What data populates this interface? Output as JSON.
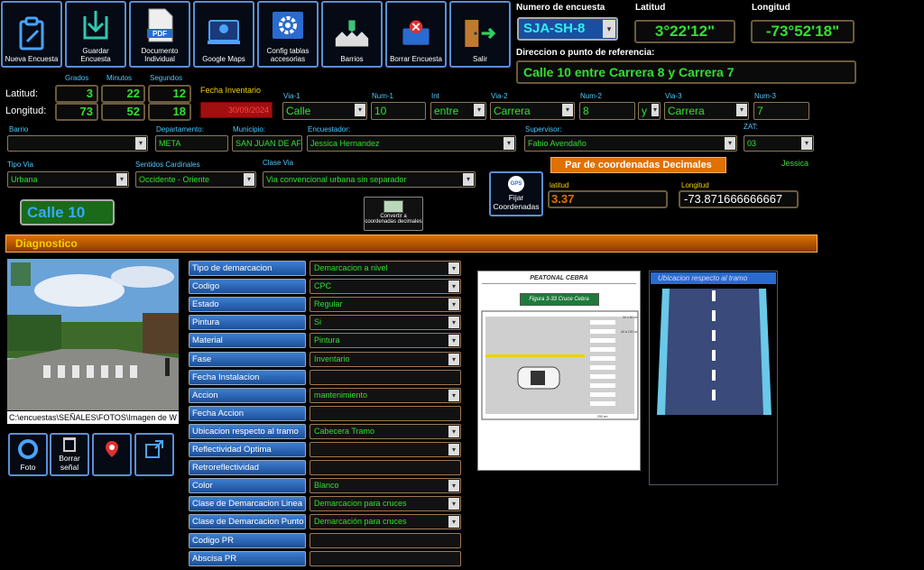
{
  "toolbar": [
    {
      "label": "Nueva Encuesta",
      "icon": "new-survey-icon"
    },
    {
      "label": "Guardar Encuesta",
      "icon": "save-icon"
    },
    {
      "label": "Documento Individual",
      "icon": "pdf-icon"
    },
    {
      "label": "Google Maps",
      "icon": "map-icon"
    },
    {
      "label": "Config tablas accesorias",
      "icon": "gear-icon"
    },
    {
      "label": "Barrios",
      "icon": "houses-icon"
    },
    {
      "label": "Borrar Encuesta",
      "icon": "delete-icon"
    },
    {
      "label": "Salir",
      "icon": "exit-icon"
    }
  ],
  "header": {
    "survey_label": "Numero de encuesta",
    "survey_value": "SJA-SH-8",
    "lat_label": "Latitud",
    "lat_value": "3°22'12\"",
    "lon_label": "Longitud",
    "lon_value": "-73°52'18\"",
    "address_label": "Direccion o punto de referencia:",
    "address_value": "Calle 10 entre Carrera 8 y Carrera 7"
  },
  "coords": {
    "grados": "Grados",
    "minutos": "Minutos",
    "segundos": "Segundos",
    "lat_label": "Latitud:",
    "lon_label": "Longitud:",
    "lat": [
      "3",
      "22",
      "12"
    ],
    "lon": [
      "73",
      "52",
      "18"
    ]
  },
  "inventory": {
    "label": "Fecha Inventario",
    "value": "30/09/2024"
  },
  "via": {
    "via1_label": "Via-1",
    "via1": "Calle",
    "num1_label": "Num-1",
    "num1": "10",
    "int_label": "Int",
    "int": "entre",
    "via2_label": "Via-2",
    "via2": "Carrera",
    "num2_label": "Num-2",
    "num2": "8",
    "sep": "y",
    "via3_label": "Via-3",
    "via3": "Carrera",
    "num3_label": "Num-3",
    "num3": "7"
  },
  "location": {
    "barrio_label": "Barrio",
    "barrio": "",
    "depto_label": "Departamento:",
    "depto": "META",
    "muni_label": "Municipio:",
    "muni": "SAN JUAN DE AF",
    "enc_label": "Encuestador:",
    "enc": "Jessica Hernandez",
    "sup_label": "Supervisor:",
    "sup": "Fabio Avendaño",
    "zat_label": "ZAT:",
    "zat": "03"
  },
  "tipo": {
    "tipo_label": "Tipo Via",
    "tipo": "Urbana",
    "sent_label": "Sentidos  Cardinales",
    "sent": "Occidente - Oriente",
    "clase_label": "Clase Via",
    "clase": "Via convencional urbana sin separador"
  },
  "decimal": {
    "title": "Par de coordenadas Decimales",
    "user": "Jessica",
    "fix_label": "Fijar Coordenadas",
    "fix_icon": "GPS",
    "lat_label": "latitud",
    "lat": "3.37",
    "lon_label": "Longitud",
    "lon": "-73.871666666667",
    "convert_label": "Convertir a coordenadas decimales"
  },
  "street_badge": "Calle 10",
  "diagnostico": {
    "title": "Diagnostico",
    "rows": [
      {
        "label": "Tipo de demarcacion",
        "value": "Demarcacion a nivel",
        "dropdown": true
      },
      {
        "label": "Codigo",
        "value": "CPC",
        "dropdown": true
      },
      {
        "label": "Estado",
        "value": "Regular",
        "dropdown": true
      },
      {
        "label": "Pintura",
        "value": "Si",
        "dropdown": true
      },
      {
        "label": "Material",
        "value": "Pintura",
        "dropdown": true
      },
      {
        "label": "Fase",
        "value": "Inventario",
        "dropdown": true
      },
      {
        "label": "Fecha Instalacion",
        "value": "",
        "dropdown": false
      },
      {
        "label": "Accion",
        "value": "mantenimiento",
        "dropdown": true
      },
      {
        "label": "Fecha Accion",
        "value": "",
        "dropdown": false
      },
      {
        "label": "Ubicacion respecto al tramo",
        "value": "Cabecera Tramo",
        "dropdown": true
      },
      {
        "label": "Reflectividad Optima",
        "value": "",
        "dropdown": true
      },
      {
        "label": "Retroreflectividad",
        "value": "",
        "dropdown": false
      },
      {
        "label": "Color",
        "value": "Blanco",
        "dropdown": true
      },
      {
        "label": "Clase de Demarcacion Linea",
        "value": "Demarcacion para cruces",
        "dropdown": true
      },
      {
        "label": "Clase de Demarcacion Punto",
        "value": "Demarcación para cruces",
        "dropdown": true
      },
      {
        "label": "Codigo PR",
        "value": "",
        "dropdown": false
      },
      {
        "label": "Abscisa PR",
        "value": "",
        "dropdown": false
      }
    ]
  },
  "photo": {
    "path": "C:\\encuestas\\SEÑALES\\FOTOS\\Imagen de W"
  },
  "photo_buttons": [
    {
      "label": "Foto",
      "icon": "camera-icon"
    },
    {
      "label": "Borrar señal",
      "icon": "trash-icon"
    },
    {
      "label": "",
      "icon": "map-pin-icon"
    },
    {
      "label": "",
      "icon": "image-export-icon"
    }
  ],
  "figure1": {
    "title": "PEATONAL CEBRA",
    "caption": "Figura 3-33 Cruce Cebra",
    "dim1": "30 x 50 cm",
    "dim2": "40 a 100 cm",
    "dim3": "250 cm"
  },
  "figure2": {
    "title": "Ubicacion respecto al tramo"
  },
  "colors": {
    "accent": "#5b8fd6",
    "green": "#30e030",
    "yellow": "#f0d000",
    "orange": "#e07000"
  }
}
